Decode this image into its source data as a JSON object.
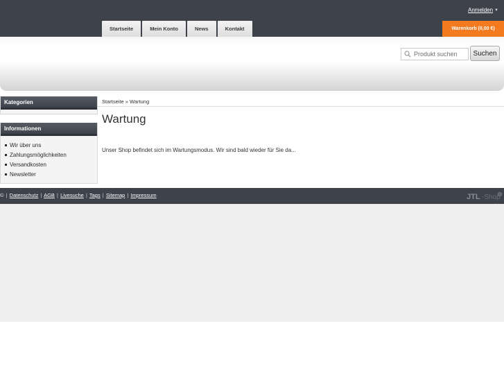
{
  "header": {
    "login_label": "Anmelden",
    "nav_tabs": [
      "Startseite",
      "Mein Konto",
      "News",
      "Kontakt"
    ],
    "cart_label": "Warenkorb (0,00 €)"
  },
  "search": {
    "placeholder": "Produkt suchen",
    "button_label": "Suchen"
  },
  "sidebar": {
    "categories_title": "Kategorien",
    "info_title": "Informationen",
    "info_items": [
      "Wir über uns",
      "Zahlungsmöglichkeiten",
      "Versandkosten",
      "Newsletter"
    ]
  },
  "breadcrumb": {
    "home": "Startseite",
    "separator": "»",
    "current": "Wartung"
  },
  "main": {
    "title": "Wartung",
    "message": "Unser Shop befindet sich im Wartungsmodus. Wir sind bald wieder für Sie da..."
  },
  "footer": {
    "copyright": "©",
    "separator": "|",
    "links": [
      "Datenschutz",
      "AGB",
      "Livesuche",
      "Tags",
      "Sitemap",
      "Impressum"
    ],
    "logo_text": "JTL-Shop"
  },
  "colors": {
    "header_bg": "#3e424b",
    "accent_orange": "#f47a20",
    "panel_bg": "#efefef"
  }
}
